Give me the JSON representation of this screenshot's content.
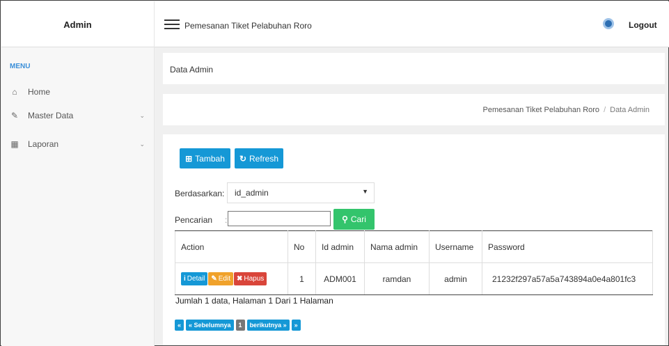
{
  "header": {
    "brand": "Admin",
    "app_title": "Pemesanan Tiket Pelabuhan Roro",
    "logout": "Logout"
  },
  "sidebar": {
    "menu_title": "MENU",
    "items": [
      {
        "label": "Home",
        "icon": "home-icon"
      },
      {
        "label": "Master Data",
        "icon": "edit-icon",
        "has_children": true
      },
      {
        "label": "Laporan",
        "icon": "calendar-icon",
        "has_children": true
      }
    ]
  },
  "page": {
    "title": "Data Admin",
    "breadcrumb": [
      "Pemesanan Tiket Pelabuhan Roro",
      "Data Admin"
    ]
  },
  "toolbar": {
    "add_label": "Tambah",
    "refresh_label": "Refresh"
  },
  "filter": {
    "by_label": "Berdasarkan:",
    "by_value": "id_admin",
    "search_label": "Pencarian",
    "search_sep": ":",
    "search_value": "",
    "search_button": "Cari"
  },
  "table": {
    "columns": [
      "Action",
      "No",
      "Id admin",
      "Nama admin",
      "Username",
      "Password"
    ],
    "actions": {
      "detail": "Detail",
      "edit": "Edit",
      "delete": "Hapus"
    },
    "rows": [
      {
        "no": "1",
        "id_admin": "ADM001",
        "nama_admin": "ramdan",
        "username": "admin",
        "password": "21232f297a57a5a743894a0e4a801fc3"
      }
    ]
  },
  "summary": "Jumlah 1 data, Halaman 1 Dari 1 Halaman",
  "pagination": {
    "first": "«",
    "prev": "« Sebelumnya",
    "current": "1",
    "next": "berikutnya »",
    "last": "»"
  },
  "colors": {
    "primary": "#1598d6",
    "success": "#33c46c",
    "warning": "#f0a22b",
    "danger": "#d9453a"
  }
}
